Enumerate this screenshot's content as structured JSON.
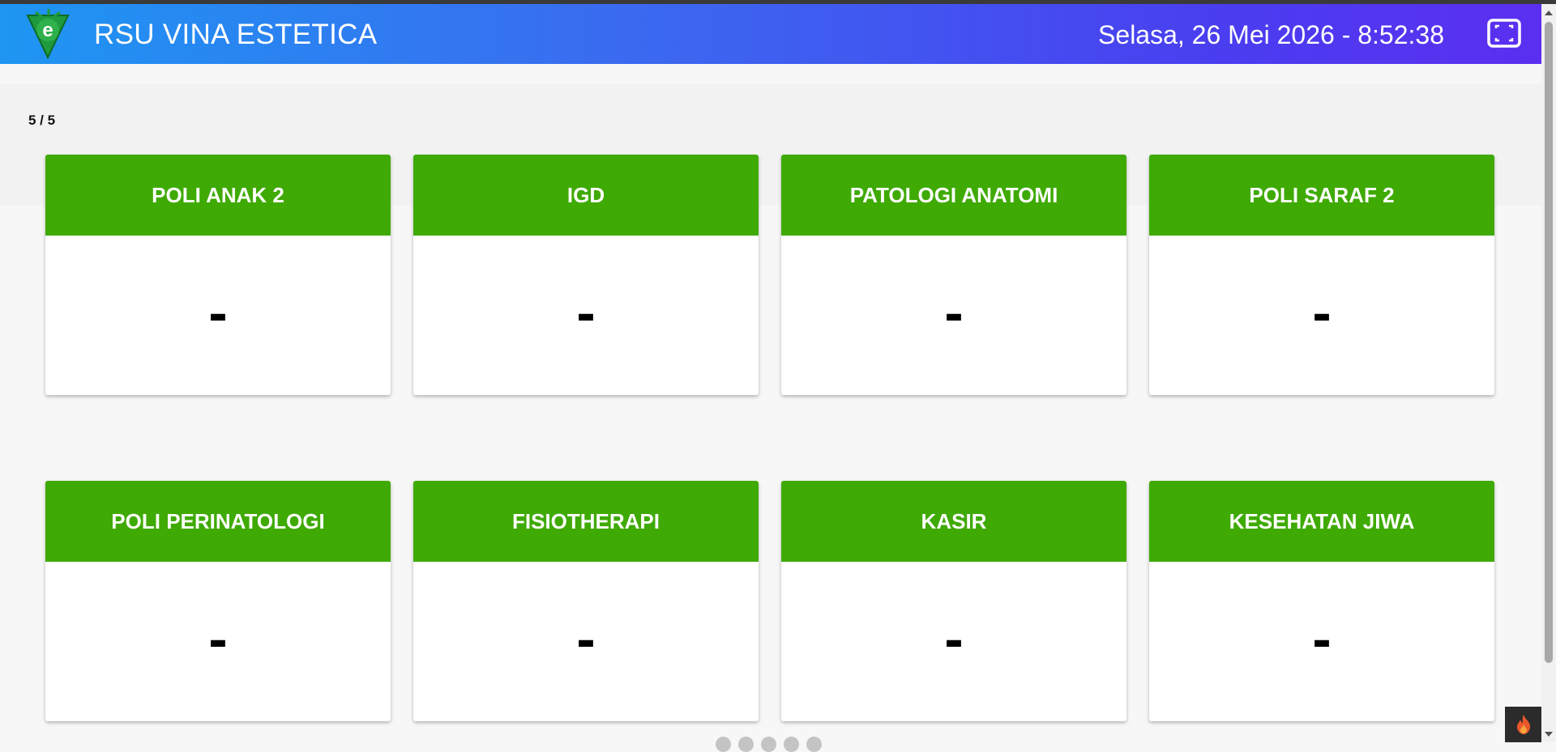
{
  "header": {
    "title": "RSU VINA ESTETICA",
    "datetime": "Selasa, 26 Mei 2026 - 8:52:38",
    "logo_icon": "leaf-e-logo",
    "fullscreen_icon": "fullscreen-icon",
    "gradient_start": "#1e96f2",
    "gradient_end": "#5b2ff0"
  },
  "page_counter": "5 / 5",
  "accent_color": "#3faa04",
  "cards": [
    {
      "name": "POLI ANAK 2",
      "value": "-"
    },
    {
      "name": "IGD",
      "value": "-"
    },
    {
      "name": "PATOLOGI ANATOMI",
      "value": "-"
    },
    {
      "name": "POLI SARAF 2",
      "value": "-"
    },
    {
      "name": "POLI PERINATOLOGI",
      "value": "-"
    },
    {
      "name": "FISIOTHERAPI",
      "value": "-"
    },
    {
      "name": "KASIR",
      "value": "-"
    },
    {
      "name": "KESEHATAN JIWA",
      "value": "-"
    }
  ],
  "pagination": {
    "count": 5
  }
}
